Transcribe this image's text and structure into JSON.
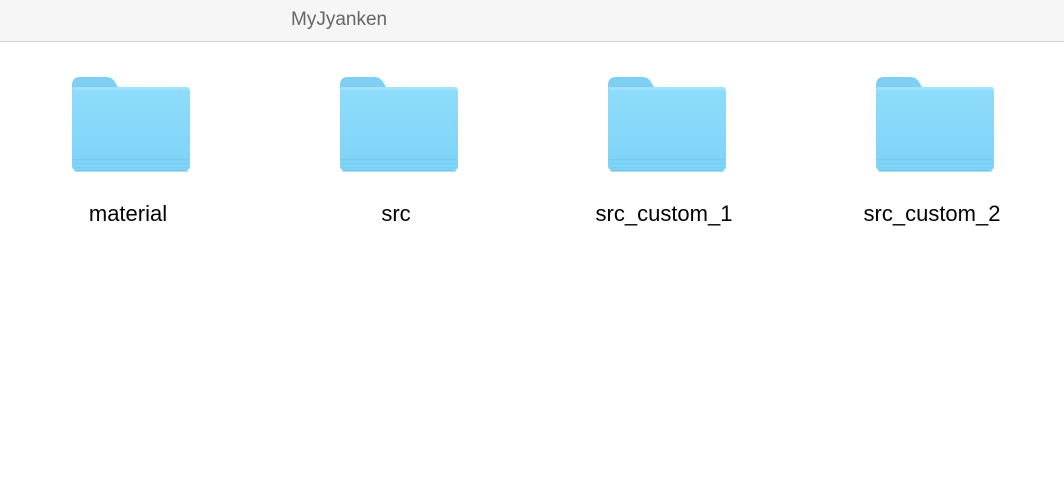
{
  "window": {
    "title": "MyJyanken"
  },
  "folder_color": {
    "tab": "#7fcff5",
    "body_top": "#8fdcfb",
    "body_bottom": "#7ed3f7",
    "stripe": "#6ec4ea"
  },
  "items": [
    {
      "name": "material",
      "icon": "folder-icon"
    },
    {
      "name": "src",
      "icon": "folder-icon"
    },
    {
      "name": "src_custom_1",
      "icon": "folder-icon"
    },
    {
      "name": "src_custom_2",
      "icon": "folder-icon"
    }
  ]
}
